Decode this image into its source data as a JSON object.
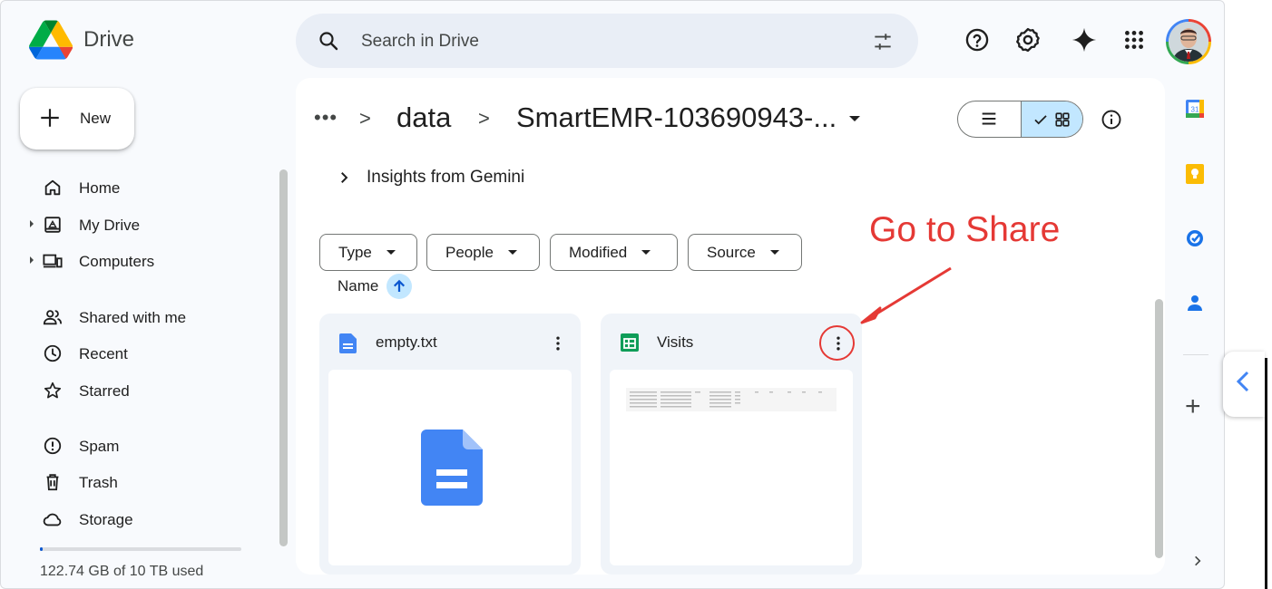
{
  "app": {
    "name": "Drive"
  },
  "search": {
    "placeholder": "Search in Drive"
  },
  "sidebar": {
    "new_label": "New",
    "items": [
      {
        "label": "Home",
        "icon": "home-icon"
      },
      {
        "label": "My Drive",
        "icon": "my-drive-icon",
        "expandable": true
      },
      {
        "label": "Computers",
        "icon": "computers-icon",
        "expandable": true
      },
      {
        "label": "Shared with me",
        "icon": "shared-icon"
      },
      {
        "label": "Recent",
        "icon": "clock-icon"
      },
      {
        "label": "Starred",
        "icon": "star-icon"
      },
      {
        "label": "Spam",
        "icon": "spam-icon"
      },
      {
        "label": "Trash",
        "icon": "trash-icon"
      },
      {
        "label": "Storage",
        "icon": "cloud-icon"
      }
    ],
    "storage_text": "122.74 GB of 10 TB used",
    "storage_fraction": 0.012
  },
  "breadcrumb": {
    "overflow": "•••",
    "sep": ">",
    "parent": "data",
    "current": "SmartEMR-103690943-..."
  },
  "insights": {
    "label": "Insights from Gemini"
  },
  "filters": [
    "Type",
    "People",
    "Modified",
    "Source"
  ],
  "sort": {
    "label": "Name",
    "direction": "ascending"
  },
  "files": [
    {
      "name": "empty.txt",
      "type": "document"
    },
    {
      "name": "Visits",
      "type": "spreadsheet"
    }
  ],
  "annotation": {
    "text": "Go to Share",
    "color": "#e53935"
  },
  "colors": {
    "accent": "#0b57d0",
    "selected_toggle": "#c2e7ff",
    "search_bg": "#e9eef6",
    "card_bg": "#f0f4f9",
    "doc_blue": "#4285f4",
    "sheet_green": "#0f9d58"
  }
}
